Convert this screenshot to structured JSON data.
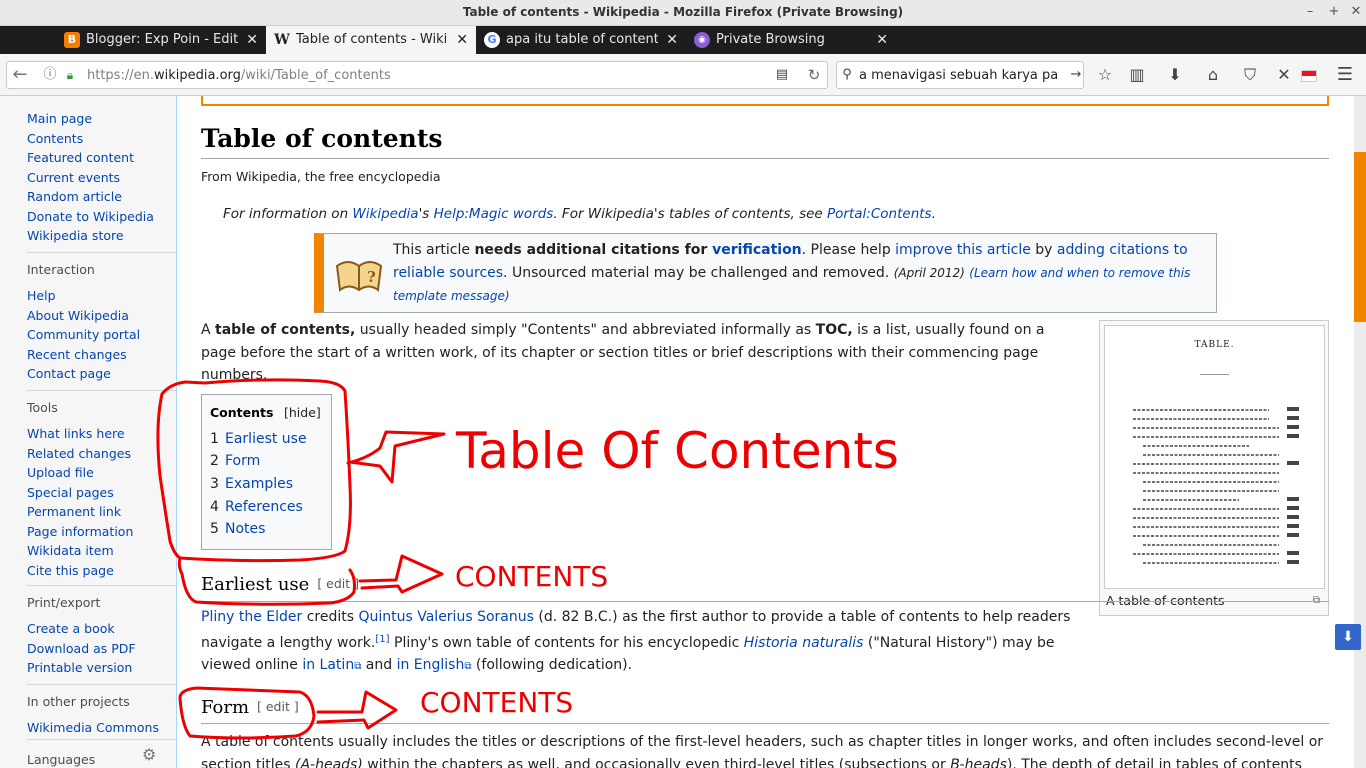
{
  "window": {
    "title": "Table of contents - Wikipedia - Mozilla Firefox (Private Browsing)"
  },
  "tabs": [
    {
      "label": "Blogger: Exp Poin - Edit ...",
      "icon": "blogger-icon",
      "active": false
    },
    {
      "label": "Table of contents - Wiki...",
      "icon": "wikipedia-icon",
      "active": true
    },
    {
      "label": "apa itu table of content...",
      "icon": "google-icon",
      "active": false
    },
    {
      "label": "Private Browsing",
      "icon": "private-mask-icon",
      "active": false
    }
  ],
  "navbar": {
    "url_prefix": "https://en.",
    "url_domain": "wikipedia.org",
    "url_path": "/wiki/Table_of_contents",
    "search_value": "a menavigasi sebuah karya panjang"
  },
  "sidebar": {
    "main": [
      "Main page",
      "Contents",
      "Featured content",
      "Current events",
      "Random article",
      "Donate to Wikipedia",
      "Wikipedia store"
    ],
    "interaction_head": "Interaction",
    "interaction": [
      "Help",
      "About Wikipedia",
      "Community portal",
      "Recent changes",
      "Contact page"
    ],
    "tools_head": "Tools",
    "tools": [
      "What links here",
      "Related changes",
      "Upload file",
      "Special pages",
      "Permanent link",
      "Page information",
      "Wikidata item",
      "Cite this page"
    ],
    "print_head": "Print/export",
    "print": [
      "Create a book",
      "Download as PDF",
      "Printable version"
    ],
    "projects_head": "In other projects",
    "projects": [
      "Wikimedia Commons"
    ],
    "languages_head": "Languages"
  },
  "article": {
    "title": "Table of contents",
    "tagline": "From Wikipedia, the free encyclopedia",
    "hatnote": {
      "t1": "For information on ",
      "l1": "Wikipedia",
      "t2": "'s ",
      "l2": "Help:Magic words",
      "t3": ". For Wikipedia's tables of contents, see ",
      "l3": "Portal:Contents",
      "t4": "."
    },
    "ambox": {
      "t1": "This article ",
      "b1": "needs additional citations for ",
      "l1": "verification",
      "t2": ". Please help ",
      "l2": "improve this article",
      "t3": " by ",
      "l3": "adding citations to reliable sources",
      "t4": ". Unsourced material may be challenged and removed. ",
      "date": "(April 2012)",
      "l4": "(Learn how and when to remove this template message)"
    },
    "intro": {
      "t1": "A ",
      "b1": "table of contents,",
      "t2": " usually headed simply \"Contents\" and abbreviated informally as ",
      "b2": "TOC,",
      "t3": " is a list, usually found on a page before the start of a written work, of its chapter or section titles or brief descriptions with their commencing page numbers."
    },
    "toc": {
      "heading": "Contents",
      "hide": "[hide]",
      "entries": [
        {
          "num": "1",
          "label": "Earliest use"
        },
        {
          "num": "2",
          "label": "Form"
        },
        {
          "num": "3",
          "label": "Examples"
        },
        {
          "num": "4",
          "label": "References"
        },
        {
          "num": "5",
          "label": "Notes"
        }
      ]
    },
    "infobox": {
      "image_title": "TABLE.",
      "caption": "A table of contents"
    },
    "sections": [
      {
        "heading": "Earliest use",
        "edit": "[ edit ]"
      },
      {
        "heading": "Form",
        "edit": "[ edit ]"
      }
    ],
    "earliest_para": {
      "l1": "Pliny the Elder",
      "t1": " credits ",
      "l2": "Quintus Valerius Soranus",
      "t2": " (d. 82 B.C.) as the first author to provide a table of contents to help readers navigate a lengthy work.",
      "ref": "[1]",
      "t3": " Pliny's own table of contents for his encyclopedic ",
      "l3": "Historia naturalis",
      "t4": " (\"Natural History\") may be viewed online ",
      "l4": "in Latin",
      "t5": " and ",
      "l5": "in English",
      "t6": " (following dedication)."
    },
    "form_para": {
      "t1": "A table of contents usually includes the titles or descriptions of the first-level headers, such as chapter titles in longer works, and often includes second-level or section titles ",
      "i1": "(A-heads)",
      "t2": " within the chapters as well, and occasionally even third-level titles (subsections or ",
      "i2": "B-heads",
      "t3": "). The depth of detail in tables of contents"
    }
  },
  "annotations": {
    "toc_label": "Table Of Contents",
    "contents_1": "CONTENTS",
    "contents_2": "CONTENTS",
    "color": "#ee0000"
  }
}
